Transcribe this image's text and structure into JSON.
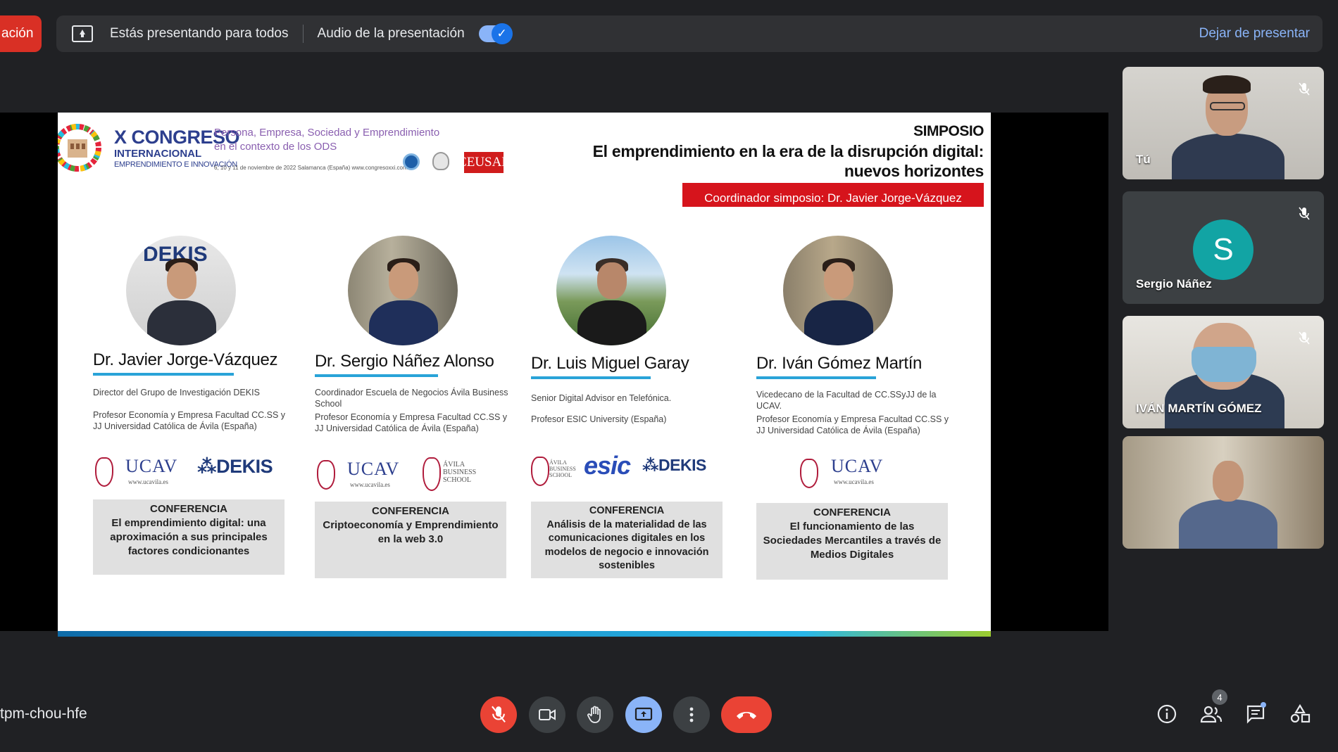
{
  "top_bar": {
    "stop_label": "ación",
    "presenting_label": "Estás presentando para todos",
    "audio_label": "Audio de la presentación",
    "audio_enabled": true,
    "leave_label": "Dejar de presentar"
  },
  "slide": {
    "congress_title": "X CONGRESO",
    "congress_sub1": "INTERNACIONAL",
    "congress_sub2": "EMPRENDIMIENTO E INNOVACIÓN",
    "tagline_1": "Persona, Empresa, Sociedad y Emprendimiento",
    "tagline_2": "en el contexto de los ODS",
    "dates": "6, 10 y 11 de noviembre de 2022    Salamanca (España)    www.congresoxxi.com",
    "ceusal_logo": "CEUSAL",
    "symposium_label": "SIMPOSIO",
    "symposium_title": "El emprendimiento en la era de la disrupción digital: nuevos horizontes",
    "coordinator": "Coordinador simposio: Dr. Javier Jorge-Vázquez",
    "speakers": [
      {
        "name": "Dr. Javier Jorge-Vázquez",
        "desc_1": "Director del Grupo de Investigación DEKIS",
        "desc_2": "Profesor Economía y Empresa Facultad CC.SS y JJ Universidad Católica de Ávila (España)",
        "photo_text": "DEKIS",
        "logo_ucav": "UCAV",
        "logo_ucav_url": "www.ucavila.es",
        "logo_dekis": "DEKIS",
        "conf_label": "CONFERENCIA",
        "conf_title": "El emprendimiento digital: una aproximación a sus principales factores condicionantes"
      },
      {
        "name": "Dr. Sergio Náñez Alonso",
        "desc_1": "Coordinador Escuela de Negocios Ávila Business School",
        "desc_2": "Profesor Economía y Empresa Facultad CC.SS y JJ Universidad Católica de Ávila (España)",
        "logo_ucav": "UCAV",
        "logo_ucav_url": "www.ucavila.es",
        "logo_avila": "ÁVILA BUSINESS SCHOOL",
        "conf_label": "CONFERENCIA",
        "conf_title": "Criptoeconomía y Emprendimiento en la web 3.0"
      },
      {
        "name": "Dr. Luis Miguel Garay",
        "desc_1": "Senior Digital Advisor en Telefónica.",
        "desc_2": "Profesor ESIC University (España)",
        "logo_avila": "ÁVILA BUSINESS SCHOOL",
        "logo_esic": "esic",
        "logo_dekis": "DEKIS",
        "conf_label": "CONFERENCIA",
        "conf_title": "Análisis de la materialidad de las comunicaciones digitales en los modelos de negocio e innovación sostenibles"
      },
      {
        "name": "Dr. Iván Gómez Martín",
        "desc_1": "Vicedecano de la Facultad de CC.SSyJJ de la UCAV.",
        "desc_2": "Profesor Economía y Empresa Facultad CC.SS y JJ Universidad Católica de Ávila (España)",
        "logo_ucav": "UCAV",
        "logo_ucav_url": "www.ucavila.es",
        "conf_label": "CONFERENCIA",
        "conf_title": "El funcionamiento de las Sociedades Mercantiles a través de Medios Digitales"
      }
    ]
  },
  "participants": [
    {
      "name": "Tú",
      "muted": true
    },
    {
      "name": "Sergio Náñez",
      "avatar_letter": "S",
      "avatar_color": "#12a4a4",
      "muted": true
    },
    {
      "name": "IVÁN MARTÍN GÓMEZ",
      "muted": true
    },
    {
      "name": "",
      "muted": false
    }
  ],
  "bottom_bar": {
    "meeting_code": "tpm-chou-hfe",
    "people_count": "4"
  },
  "colors": {
    "accent_blue": "#8ab4f8",
    "danger_red": "#ea4335",
    "bar_bg": "#303134"
  }
}
